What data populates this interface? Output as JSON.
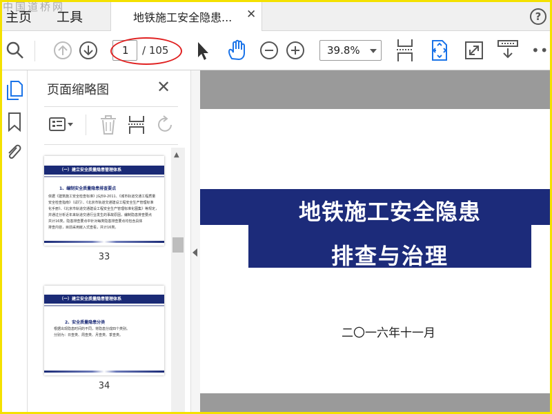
{
  "watermark": "中国道桥网",
  "nav": {
    "home": "主页",
    "tools": "工具"
  },
  "document_tab": {
    "title": "地铁施工安全隐患...",
    "close": "✕"
  },
  "help": "?",
  "toolbar": {
    "current_page": "1",
    "total_pages": "/ 105",
    "zoom": "39.8%",
    "more": "•••"
  },
  "panel": {
    "title": "页面缩略图",
    "close": "✕",
    "thumbnails": [
      {
        "page_number": "33",
        "bar": "（一）建立安全质量隐患管理体系",
        "heading": "1、编制安全质量隐患排查要点",
        "lines": [
          "依据《建筑施工安全检查标准》JGJ59-2011、《城市轨道交通工程质量",
          "安全检查指南》（试行）、《北京市轨道交通建设工程安全生产管理标准",
          "化手册》、《北京市轨道交通建设工程安全生产管理标准化图集》等规定，",
          "并通过分析近年来轨道交通行业发生的事故原因，编制隐患排查要点",
          "共计16类，隐患排查要点中针对每类隐患排查要点均包含具体",
          "排查内容，目前采用嵌入式查看，共计16类。"
        ]
      },
      {
        "page_number": "34",
        "bar": "（一）建立安全质量隐患管理体系",
        "heading": "2、安全质量隐患分类",
        "lines": [
          "根据出现隐患时间的不同，将隐患分成四个类别。",
          "分别为：日查类、周查类、月查类、季查类。"
        ]
      }
    ]
  },
  "document": {
    "title_line1": "地铁施工安全隐患",
    "title_line2": "排查与治理",
    "date": "二〇一六年十一月"
  },
  "colors": {
    "accent_blue": "#1c2b7a",
    "active_blue": "#1a73e8",
    "annotation_red": "#e02020",
    "frame_yellow": "#f4e100"
  }
}
